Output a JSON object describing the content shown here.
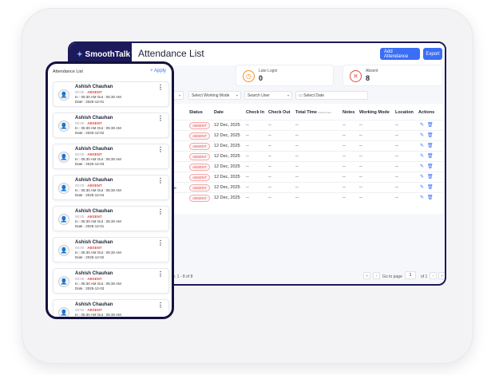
{
  "app": {
    "brand": "SmoothTalk",
    "brand_sup": "™",
    "page_title": "Attendance List",
    "add_attendance_label": "Add Attendance",
    "export_label": "Export"
  },
  "stats": [
    {
      "label": "Late Login",
      "value": "0",
      "color": "#f28c2b"
    },
    {
      "label": "Absent",
      "value": "8",
      "color": "#e24b4b"
    }
  ],
  "filters": {
    "working_mode": "Select Working Mode",
    "user": "Search User",
    "date": "Select Date"
  },
  "table": {
    "headers": [
      "Status",
      "Date",
      "Check In",
      "Check Out",
      "Total Time",
      "Notes",
      "Working Mode",
      "Location",
      "Actions"
    ],
    "total_time_sub": "(HH:mm:ss)",
    "rows": [
      {
        "status": "ABSENT",
        "date": "12 Dec, 2025",
        "check_in": "--",
        "check_out": "--",
        "total": "--",
        "notes": "--",
        "mode": "--",
        "location": "--"
      },
      {
        "status": "ABSENT",
        "date": "12 Dec, 2025",
        "check_in": "--",
        "check_out": "--",
        "total": "--",
        "notes": "--",
        "mode": "--",
        "location": "--"
      },
      {
        "status": "ABSENT",
        "date": "12 Dec, 2025",
        "check_in": "--",
        "check_out": "--",
        "total": "--",
        "notes": "--",
        "mode": "--",
        "location": "--"
      },
      {
        "status": "ABSENT",
        "date": "12 Dec, 2025",
        "check_in": "--",
        "check_out": "--",
        "total": "--",
        "notes": "--",
        "mode": "--",
        "location": "--"
      },
      {
        "status": "ABSENT",
        "date": "12 Dec, 2025",
        "check_in": "--",
        "check_out": "--",
        "total": "--",
        "notes": "--",
        "mode": "--",
        "location": "--"
      },
      {
        "status": "ABSENT",
        "date": "12 Dec, 2025",
        "check_in": "--",
        "check_out": "--",
        "total": "--",
        "notes": "--",
        "mode": "--",
        "location": "--"
      },
      {
        "status": "ABSENT",
        "date": "12 Dec, 2025",
        "check_in": "--",
        "check_out": "--",
        "total": "--",
        "notes": "--",
        "mode": "--",
        "location": "--"
      },
      {
        "status": "ABSENT",
        "date": "12 Dec, 2025",
        "check_in": "--",
        "check_out": "--",
        "total": "--",
        "notes": "--",
        "mode": "--",
        "location": "--"
      }
    ],
    "behind_text": "ar"
  },
  "footer": {
    "results": "ts: 1 - 8 of 8",
    "go_to_page": "Go to page",
    "page_value": "1",
    "of_pages": "of 1"
  },
  "mobile": {
    "header": "Attendance List",
    "apply": "+ Apply",
    "cards": [
      {
        "name": "Ashish Chauhan",
        "time": "00:00",
        "status": "ABSENT",
        "inout": "In : 05:30 AM  Out : 05:30 AM",
        "date": "Date : 2025-12-01"
      },
      {
        "name": "Ashish Chauhan",
        "time": "00:00",
        "status": "ABSENT",
        "inout": "In : 05:30 AM  Out : 05:30 AM",
        "date": "Date : 2025-12-02"
      },
      {
        "name": "Ashish Chauhan",
        "time": "00:00",
        "status": "ABSENT",
        "inout": "In : 05:30 AM  Out : 05:30 AM",
        "date": "Date : 2025-12-03"
      },
      {
        "name": "Ashish Chauhan",
        "time": "00:00",
        "status": "ABSENT",
        "inout": "In : 05:30 AM  Out : 05:30 AM",
        "date": "Date : 2025-12-04"
      },
      {
        "name": "Ashish Chauhan",
        "time": "00:00",
        "status": "ABSENT",
        "inout": "In : 05:30 AM  Out : 05:30 AM",
        "date": "Date : 2025-12-01"
      },
      {
        "name": "Ashish Chauhan",
        "time": "00:00",
        "status": "ABSENT",
        "inout": "In : 05:30 AM  Out : 05:30 AM",
        "date": "Date : 2025-12-02"
      },
      {
        "name": "Ashish Chauhan",
        "time": "00:00",
        "status": "ABSENT",
        "inout": "In : 05:30 AM  Out : 05:30 AM",
        "date": "Date : 2025-12-03"
      },
      {
        "name": "Ashish Chauhan",
        "time": "00:00",
        "status": "ABSENT",
        "inout": "In : 05:30 AM  Out : 05:30 AM",
        "date": ""
      }
    ]
  }
}
